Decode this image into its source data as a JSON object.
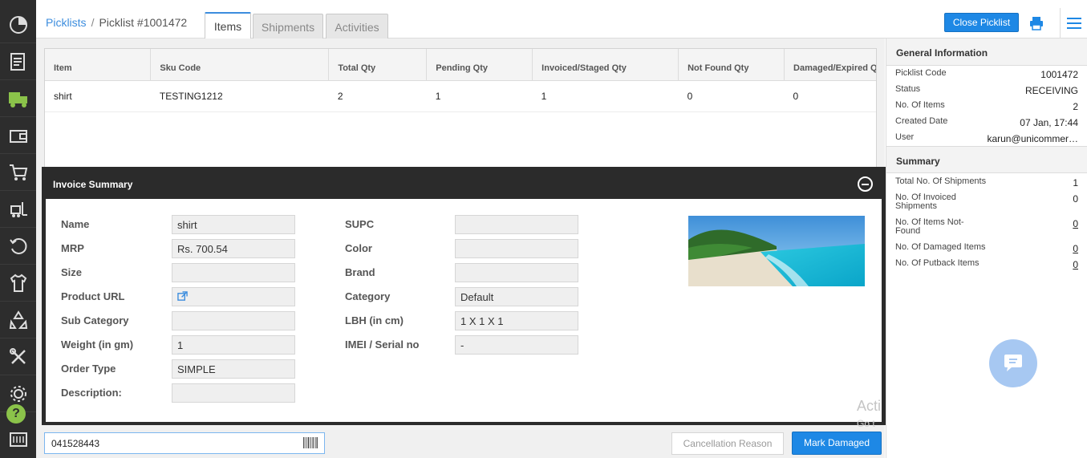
{
  "breadcrumb": {
    "root": "Picklists",
    "separator": "/",
    "current": "Picklist #1001472"
  },
  "tabs": [
    {
      "label": "Items",
      "active": true
    },
    {
      "label": "Shipments",
      "active": false
    },
    {
      "label": "Activities",
      "active": false
    }
  ],
  "header": {
    "close_label": "Close Picklist",
    "print_icon": "printer-icon",
    "menu_icon": "hamburger-menu-icon"
  },
  "nav_icons": [
    "dashboard-icon",
    "orders-icon",
    "shipping-truck-icon",
    "wallet-icon",
    "cart-icon",
    "forklift-icon",
    "returns-icon",
    "apparel-icon",
    "recycle-icon",
    "tools-icon",
    "settings-gear-icon",
    "help-icon",
    "barcode-scan-icon"
  ],
  "table": {
    "columns": [
      "Item",
      "Sku Code",
      "Total Qty",
      "Pending Qty",
      "Invoiced/Staged Qty",
      "Not Found Qty",
      "Damaged/Expired Q"
    ],
    "rows": [
      [
        "shirt",
        "TESTING1212",
        "2",
        "1",
        "1",
        "0",
        "0"
      ]
    ]
  },
  "invoice_summary": {
    "title": "Invoice Summary",
    "left_fields": [
      {
        "label": "Name",
        "value": "shirt"
      },
      {
        "label": "MRP",
        "value": "Rs. 700.54"
      },
      {
        "label": "Size",
        "value": ""
      },
      {
        "label": "Product URL",
        "value": ""
      },
      {
        "label": "Sub Category",
        "value": ""
      },
      {
        "label": "Weight (in gm)",
        "value": "1"
      },
      {
        "label": "Order Type",
        "value": "SIMPLE"
      },
      {
        "label": "Description:",
        "value": ""
      }
    ],
    "right_fields": [
      {
        "label": "SUPC",
        "value": ""
      },
      {
        "label": "Color",
        "value": ""
      },
      {
        "label": "Brand",
        "value": ""
      },
      {
        "label": "Category",
        "value": "Default"
      },
      {
        "label": "LBH (in cm)",
        "value": "1 X 1 X 1"
      },
      {
        "label": "IMEI / Serial no",
        "value": "-"
      }
    ]
  },
  "bottom_bar": {
    "barcode_value": "041528443",
    "cancel_label": "Cancellation Reason",
    "mark_damaged_label": "Mark Damaged"
  },
  "general_information": {
    "title": "General Information",
    "rows": [
      {
        "label": "Picklist Code",
        "value": "1001472"
      },
      {
        "label": "Status",
        "value": "RECEIVING"
      },
      {
        "label": "No. Of Items",
        "value": "2"
      },
      {
        "label": "Created Date",
        "value": "07 Jan, 17:44"
      },
      {
        "label": "User",
        "value": "karun@unicommer…"
      }
    ]
  },
  "summary": {
    "title": "Summary",
    "rows": [
      {
        "label": "Total No. Of Shipments",
        "value": "1"
      },
      {
        "label": "No. Of Invoiced Shipments",
        "value": "0"
      },
      {
        "label": "No. Of Items Not-Found",
        "value": "0"
      },
      {
        "label": "No. Of Damaged Items",
        "value": "0"
      },
      {
        "label": "No. Of Putback Items",
        "value": "0"
      }
    ]
  },
  "watermark": {
    "line1": "Acti",
    "line2": "Go t"
  },
  "colors": {
    "accent": "#1e88e5",
    "link": "#3c8dde",
    "rail": "#2d2d2d",
    "rail_active": "#8bc34a"
  }
}
